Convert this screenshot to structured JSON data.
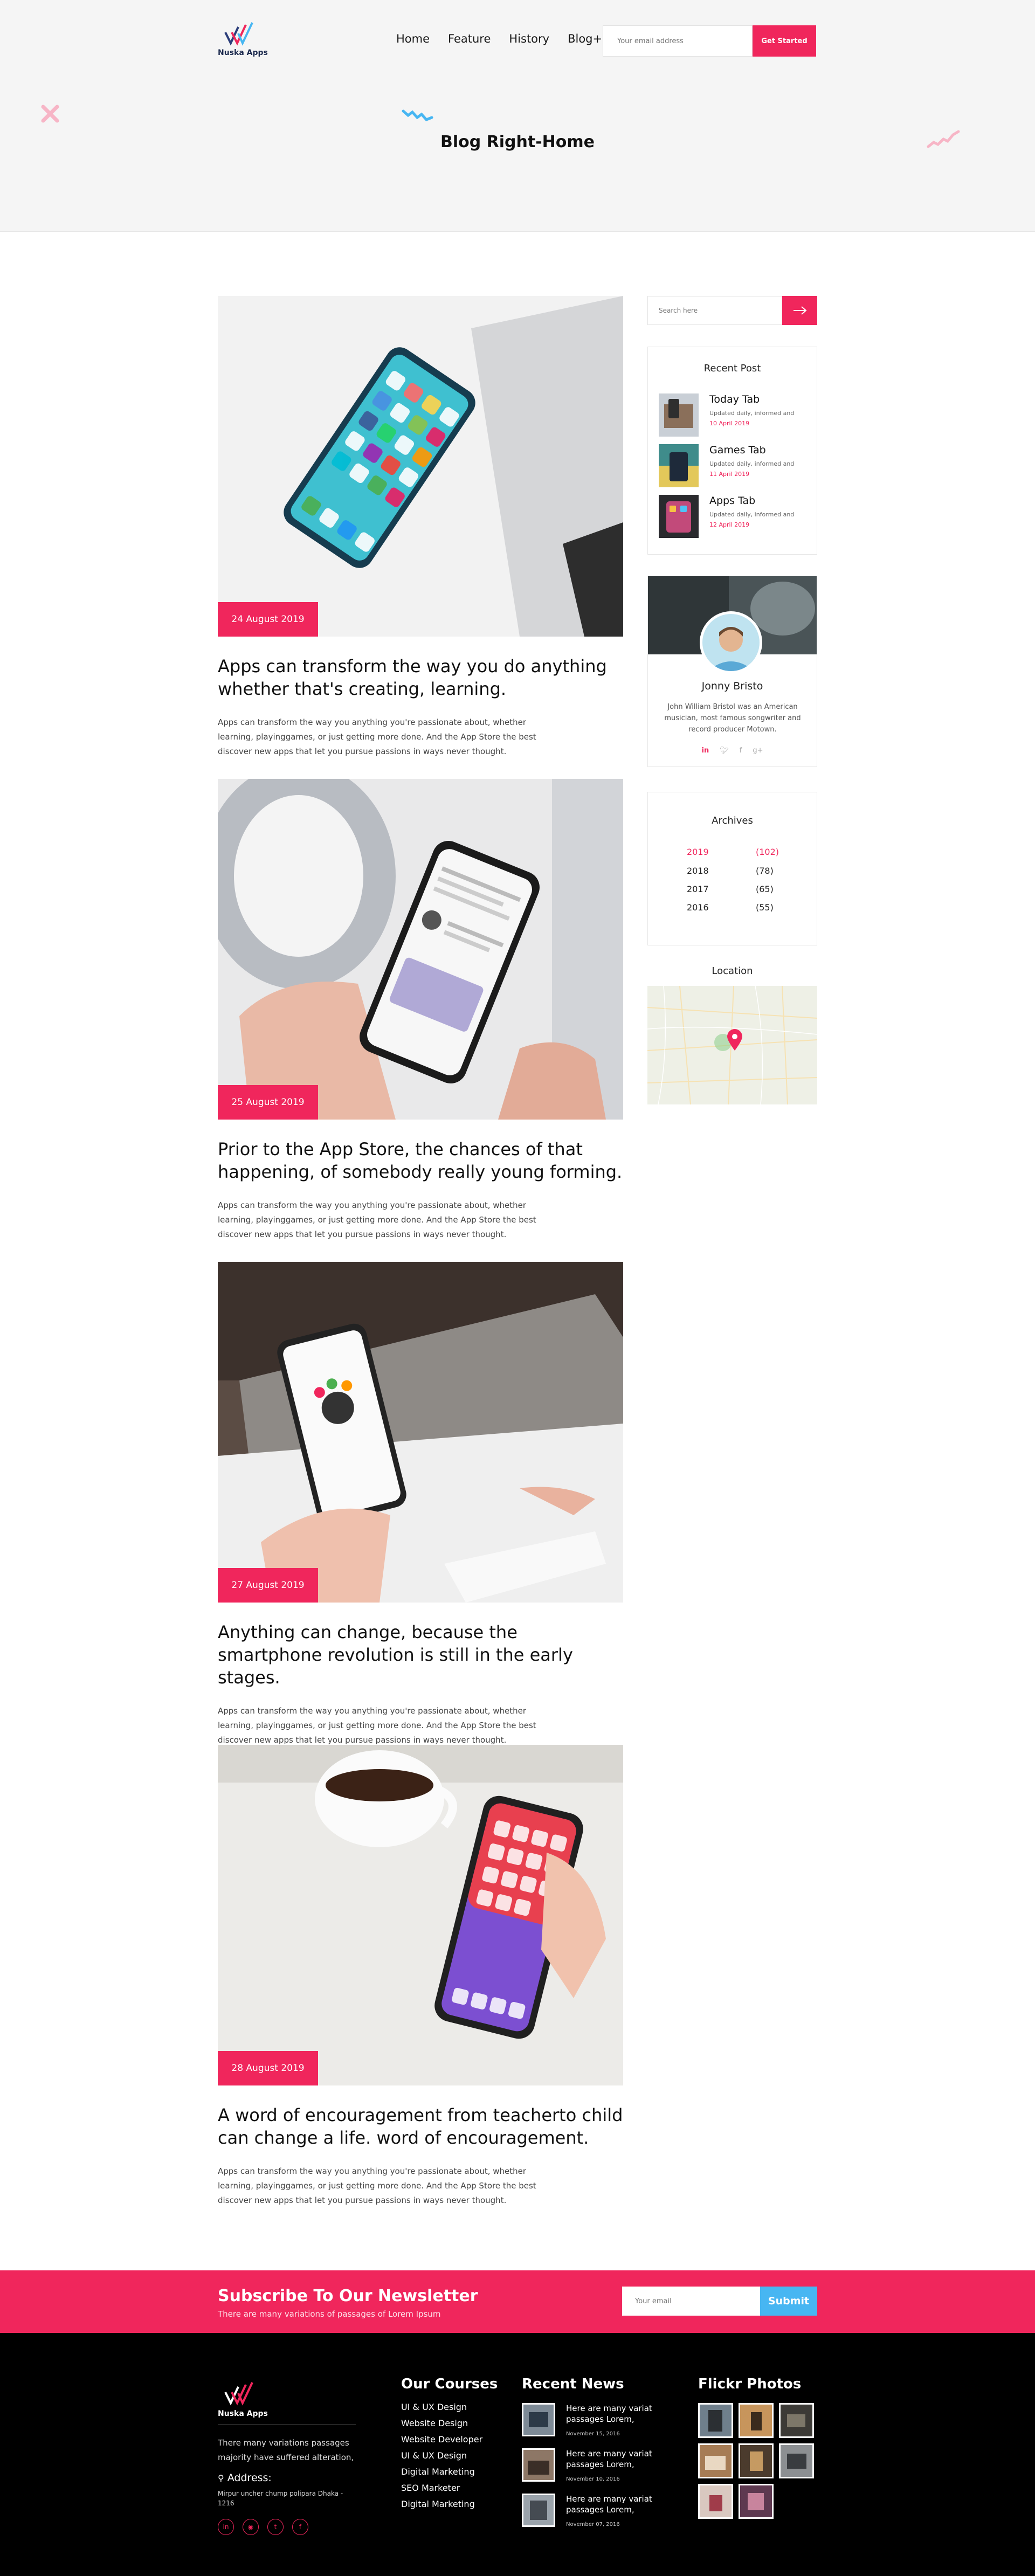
{
  "brand": {
    "name": "Nuska Apps",
    "accent_color": "#f0265c",
    "secondary_color": "#47b6f2"
  },
  "header": {
    "nav": [
      "Home",
      "Feature",
      "History",
      "Blog+"
    ],
    "email_placeholder": "Your email address",
    "cta_label": "Get Started",
    "page_title": "Blog Right-Home"
  },
  "posts": [
    {
      "date": "24 August 2019",
      "title": "Apps can transform the way you do anything whether that's creating, learning.",
      "excerpt": "Apps can transform the way you anything you're passionate about, whether learning, playinggames, or just getting more done. And the App Store the best discover new apps that let you pursue passions in ways never thought."
    },
    {
      "date": "25 August 2019",
      "title": "Prior to the App Store, the chances of that happening, of somebody really young forming.",
      "excerpt": "Apps can transform the way you anything you're passionate about, whether learning, playinggames, or just getting more done. And the App Store the best discover new apps that let you pursue passions in ways never thought."
    },
    {
      "date": "27 August 2019",
      "title": "Anything can change, because the smartphone revolution is still in the early stages.",
      "excerpt": "Apps can transform the way you anything you're passionate about, whether learning, playinggames, or just getting more done. And the App Store the best discover new apps that let you pursue passions in ways never thought."
    },
    {
      "date": "28 August 2019",
      "title": "A word of encouragement from teacherto child can change a life. word of encouragement.",
      "excerpt": "Apps can transform the way you anything you're passionate about, whether learning, playinggames, or just getting more done. And the App Store the best discover new apps that let you pursue passions in ways never thought."
    }
  ],
  "sidebar": {
    "search_placeholder": "Search here",
    "search_icon": "arrow-right-icon",
    "recent": {
      "title": "Recent Post",
      "items": [
        {
          "title": "Today Tab",
          "desc": "Updated daily,  informed and",
          "date": "10 April 2019"
        },
        {
          "title": "Games Tab",
          "desc": "Updated daily,  informed and",
          "date": "11 April 2019"
        },
        {
          "title": "Apps Tab",
          "desc": "Updated daily,  informed and",
          "date": "12 April 2019"
        }
      ]
    },
    "author": {
      "name": "Jonny Bristo",
      "bio": "John William Bristol was an American musician, most famous songwriter and record producer Motown.",
      "social_icons": [
        "linkedin-icon",
        "twitter-icon",
        "facebook-icon",
        "google-plus-icon"
      ]
    },
    "archives": {
      "title": "Archives",
      "rows": [
        {
          "year": "2019",
          "count": "(102)"
        },
        {
          "year": "2018",
          "count": "(78)"
        },
        {
          "year": "2017",
          "count": "(65)"
        },
        {
          "year": "2016",
          "count": "(55)"
        }
      ]
    },
    "location_title": "Location"
  },
  "newsletter": {
    "title": "Subscribe To Our Newsletter",
    "subtitle": "There are many variations of passages of Lorem Ipsum",
    "placeholder": "Your email",
    "button": "Submit"
  },
  "footer": {
    "brand": "Nuska Apps",
    "description": "There many variations passages majority have suffered alteration,",
    "address_label": "Address:",
    "address": "Mirpur uncher chump polipara Dhaka - 1216",
    "social_icons": [
      "linkedin-icon",
      "instagram-icon",
      "twitter-icon",
      "facebook-icon"
    ],
    "courses_title": "Our Courses",
    "courses": [
      "UI & UX Design",
      "Website Design",
      "Website Developer",
      "UI & UX Design",
      "Digital Marketing",
      "SEO Marketer",
      "Digital Marketing"
    ],
    "news_title": "Recent News",
    "news": [
      {
        "title": "Here are many variat passages Lorem,",
        "date": "November 15, 2016"
      },
      {
        "title": "Here are many variat passages Lorem,",
        "date": "November 10, 2016"
      },
      {
        "title": "Here are many variat passages Lorem,",
        "date": "November 07, 2016"
      }
    ],
    "flickr_title": "Flickr Photos"
  }
}
